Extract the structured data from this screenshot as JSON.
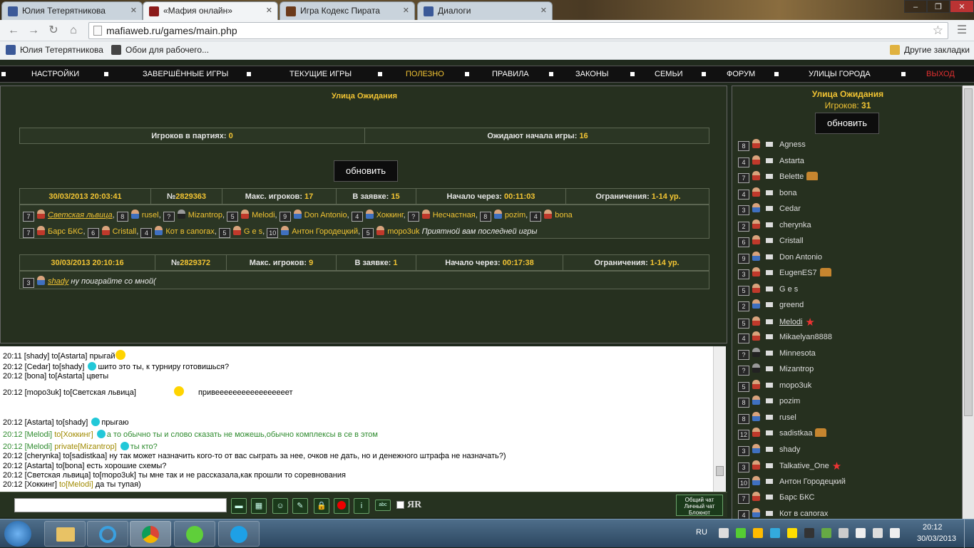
{
  "browser": {
    "tabs": [
      {
        "label": "Юлия Тетерятникова",
        "color": "#3b5998"
      },
      {
        "label": "«Мафия онлайн»",
        "color": "#8b1a1a"
      },
      {
        "label": "Игра Кодекс Пирата",
        "color": "#6b3a1a"
      },
      {
        "label": "Диалоги",
        "color": "#3b5998"
      }
    ],
    "url": "mafiaweb.ru/games/main.php",
    "bookmarks": [
      {
        "label": "Юлия Тетерятникова"
      },
      {
        "label": "Обои для рабочего..."
      }
    ],
    "other_bookmarks": "Другие закладки"
  },
  "nav": {
    "items": [
      "НАСТРОЙКИ",
      "ЗАВЕРШЁННЫЕ ИГРЫ",
      "ТЕКУЩИЕ ИГРЫ",
      "ПОЛЕЗНО",
      "ПРАВИЛА",
      "ЗАКОНЫ",
      "СЕМЬИ",
      "ФОРУМ",
      "УЛИЦЫ ГОРОДА",
      "ВЫХОД"
    ]
  },
  "main": {
    "title": "Улица Ожидания",
    "in_games_label": "Игроков в партиях:",
    "in_games": "0",
    "waiting_label": "Ожидают начала игры:",
    "waiting": "16",
    "refresh": "обновить",
    "games": [
      {
        "date": "30/03/2013 20:03:41",
        "id_prefix": "№",
        "id": "2829363",
        "max_label": "Макс. игроков:",
        "max": "17",
        "applied_label": "В заявке:",
        "applied": "15",
        "start_label": "Начало через:",
        "start": "00:11:03",
        "limit_label": "Ограничения:",
        "limit": "1-14 ур."
      },
      {
        "date": "30/03/2013 20:10:16",
        "id_prefix": "№",
        "id": "2829372",
        "max_label": "Макс. игроков:",
        "max": "9",
        "applied_label": "В заявке:",
        "applied": "1",
        "start_label": "Начало через:",
        "start": "00:17:38",
        "limit_label": "Ограничения:",
        "limit": "1-14 ур."
      }
    ],
    "game1_row1": [
      {
        "lvl": "7",
        "name": "Светская львица",
        "g": "f",
        "u": true
      },
      {
        "lvl": "8",
        "name": "rusel",
        "g": "m"
      },
      {
        "lvl": "?",
        "name": "Mizantrop",
        "g": "u"
      },
      {
        "lvl": "5",
        "name": "Melodi",
        "g": "f"
      },
      {
        "lvl": "9",
        "name": "Don Antonio",
        "g": "m"
      },
      {
        "lvl": "4",
        "name": "Хоккинг",
        "g": "m"
      },
      {
        "lvl": "?",
        "name": "Несчастная",
        "g": "f"
      },
      {
        "lvl": "8",
        "name": "pozim",
        "g": "m"
      },
      {
        "lvl": "4",
        "name": "bona",
        "g": "f"
      }
    ],
    "game1_row2": [
      {
        "lvl": "7",
        "name": "Барс БКС",
        "g": "f"
      },
      {
        "lvl": "6",
        "name": "Cristall",
        "g": "f"
      },
      {
        "lvl": "4",
        "name": "Кот в сапогах",
        "g": "m"
      },
      {
        "lvl": "5",
        "name": "G e s",
        "g": "f"
      },
      {
        "lvl": "10",
        "name": "Антон Городецкий",
        "g": "m"
      },
      {
        "lvl": "5",
        "name": "mopo3uk",
        "g": "f"
      }
    ],
    "game1_comment": "Приятной вам последней игры",
    "game2_player": {
      "lvl": "3",
      "name": "shady",
      "g": "m"
    },
    "game2_comment": "ну поиграйте со мной("
  },
  "chat": [
    {
      "time": "20:11",
      "from": "[shady]",
      "to": "to[Astarta]",
      "msg": "прыгай"
    },
    {
      "time": "20:12",
      "from": "[Cedar]",
      "to": "to[shady]",
      "msg": "шито это ты, к турниру готовишься?"
    },
    {
      "time": "20:12",
      "from": "[bona]",
      "to": "to[Astarta]",
      "msg": "цветы"
    },
    {
      "time": "20:12",
      "from": "[mopo3uk]",
      "to": "to[Светская львица]",
      "msg": "привееееееееееееееееет"
    },
    {
      "time": "20:12",
      "from": "[Astarta]",
      "to": "to[shady]",
      "msg": "прыгаю"
    },
    {
      "time": "20:12",
      "from": "[Melodi]",
      "to": "to[Хоккинг]",
      "msg": "а то обычно ты и слово сказать не можешь,обычно комплексы в се в этом"
    },
    {
      "time": "20:12",
      "from": "[Melodi]",
      "to": "private[Mizantrop]",
      "msg": "ты кто?"
    },
    {
      "time": "20:12",
      "from": "[cherynka]",
      "to": "to[sadistkaa]",
      "msg": "ну так может назначить кого-то от вас сыграть за нее, очков не дать, но и денежного штрафа не назначать?)"
    },
    {
      "time": "20:12",
      "from": "[Astarta]",
      "to": "to[bona]",
      "msg": "есть хорошие схемы?"
    },
    {
      "time": "20:12",
      "from": "[Светская львица]",
      "to": "to[mopo3uk]",
      "msg": "ты мне так и не рассказала,как прошли то соревнования"
    },
    {
      "time": "20:12",
      "from": "[Хоккинг]",
      "to": "to[Melodi]",
      "msg": "да ты тупая)"
    }
  ],
  "chatbar": {
    "ya": "ЯR",
    "tabs": [
      "Общий чат",
      "Личный чат",
      "Блокнот"
    ]
  },
  "side": {
    "title": "Улица Ожидания",
    "count_label": "Игроков:",
    "count": "31",
    "refresh": "обновить",
    "players": [
      {
        "lvl": "8",
        "name": "Agness",
        "g": "f"
      },
      {
        "lvl": "4",
        "name": "Astarta",
        "g": "f"
      },
      {
        "lvl": "7",
        "name": "Belette",
        "g": "f",
        "badge": "crown"
      },
      {
        "lvl": "4",
        "name": "bona",
        "g": "f"
      },
      {
        "lvl": "3",
        "name": "Cedar",
        "g": "m"
      },
      {
        "lvl": "2",
        "name": "cherynka",
        "g": "f"
      },
      {
        "lvl": "6",
        "name": "Cristall",
        "g": "f"
      },
      {
        "lvl": "9",
        "name": "Don Antonio",
        "g": "m"
      },
      {
        "lvl": "3",
        "name": "EugenES7",
        "g": "f",
        "badge": "crown"
      },
      {
        "lvl": "5",
        "name": "G e s",
        "g": "f"
      },
      {
        "lvl": "2",
        "name": "greend",
        "g": "m"
      },
      {
        "lvl": "5",
        "name": "Melodi",
        "g": "f",
        "badge": "star",
        "u": true
      },
      {
        "lvl": "4",
        "name": "Mikaelyan8888",
        "g": "f"
      },
      {
        "lvl": "?",
        "name": "Minnesota",
        "g": "u"
      },
      {
        "lvl": "?",
        "name": "Mizantrop",
        "g": "u"
      },
      {
        "lvl": "5",
        "name": "mopo3uk",
        "g": "f"
      },
      {
        "lvl": "8",
        "name": "pozim",
        "g": "m"
      },
      {
        "lvl": "8",
        "name": "rusel",
        "g": "m"
      },
      {
        "lvl": "12",
        "name": "sadistkaa",
        "g": "f",
        "badge": "crown"
      },
      {
        "lvl": "3",
        "name": "shady",
        "g": "m"
      },
      {
        "lvl": "3",
        "name": "Talkative_One",
        "g": "f",
        "badge": "star"
      },
      {
        "lvl": "10",
        "name": "Антон Городецкий",
        "g": "m"
      },
      {
        "lvl": "7",
        "name": "Барс БКС",
        "g": "f"
      },
      {
        "lvl": "4",
        "name": "Кот в сапогах",
        "g": "m"
      }
    ]
  },
  "taskbar": {
    "lang": "RU",
    "time": "20:12",
    "date": "30/03/2013"
  }
}
